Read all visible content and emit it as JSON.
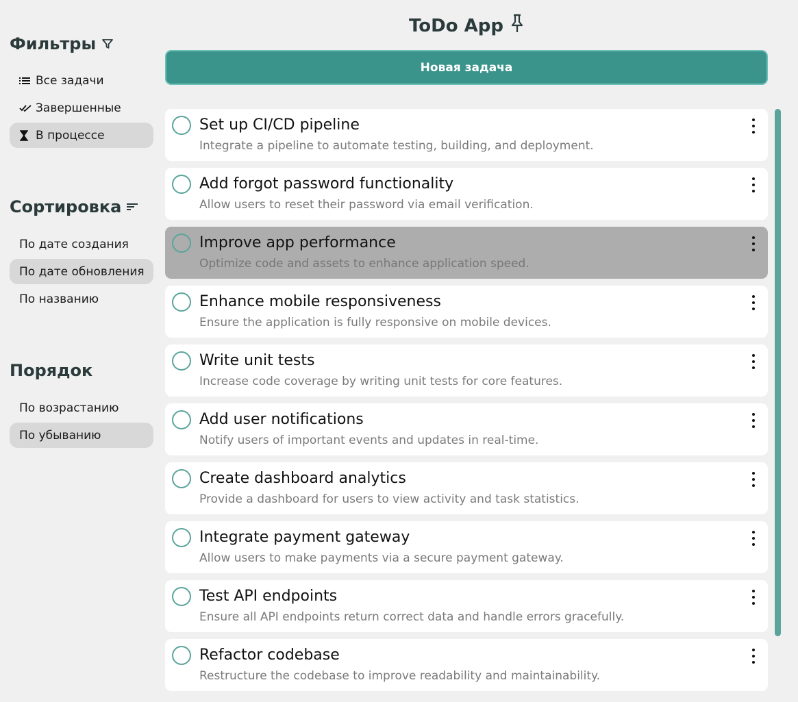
{
  "app": {
    "title": "ToDo App",
    "pin_icon": "pin-icon",
    "new_task_label": "Новая задача"
  },
  "filters": {
    "title": "Фильтры",
    "icon": "filter-icon",
    "items": [
      {
        "label": "Все задачи",
        "icon": "list-icon",
        "active": false
      },
      {
        "label": "Завершенные",
        "icon": "double-check-icon",
        "active": false
      },
      {
        "label": "В процессе",
        "icon": "hourglass-icon",
        "active": true
      }
    ]
  },
  "sorting": {
    "title": "Сортировка",
    "icon": "sort-icon",
    "items": [
      {
        "label": "По дате создания",
        "active": false
      },
      {
        "label": "По дате обновления",
        "active": true
      },
      {
        "label": "По названию",
        "active": false
      }
    ]
  },
  "order": {
    "title": "Порядок",
    "items": [
      {
        "label": "По возрастанию",
        "active": false
      },
      {
        "label": "По убыванию",
        "active": true
      }
    ]
  },
  "tasks": [
    {
      "title": "Set up CI/CD pipeline",
      "description": "Integrate a pipeline to automate testing, building, and deployment.",
      "highlighted": false
    },
    {
      "title": "Add forgot password functionality",
      "description": "Allow users to reset their password via email verification.",
      "highlighted": false
    },
    {
      "title": "Improve app performance",
      "description": "Optimize code and assets to enhance application speed.",
      "highlighted": true
    },
    {
      "title": "Enhance mobile responsiveness",
      "description": "Ensure the application is fully responsive on mobile devices.",
      "highlighted": false
    },
    {
      "title": "Write unit tests",
      "description": "Increase code coverage by writing unit tests for core features.",
      "highlighted": false
    },
    {
      "title": "Add user notifications",
      "description": "Notify users of important events and updates in real-time.",
      "highlighted": false
    },
    {
      "title": "Create dashboard analytics",
      "description": "Provide a dashboard for users to view activity and task statistics.",
      "highlighted": false
    },
    {
      "title": "Integrate payment gateway",
      "description": "Allow users to make payments via a secure payment gateway.",
      "highlighted": false
    },
    {
      "title": "Test API endpoints",
      "description": "Ensure all API endpoints return correct data and handle errors gracefully.",
      "highlighted": false
    },
    {
      "title": "Refactor codebase",
      "description": "Restructure the codebase to improve readability and maintainability.",
      "highlighted": false
    }
  ],
  "colors": {
    "accent": "#3b948c",
    "accent_light": "#5aa49b",
    "background": "#f0f0f0",
    "active_item": "#d8d8d8",
    "highlight_task": "#adadad"
  }
}
